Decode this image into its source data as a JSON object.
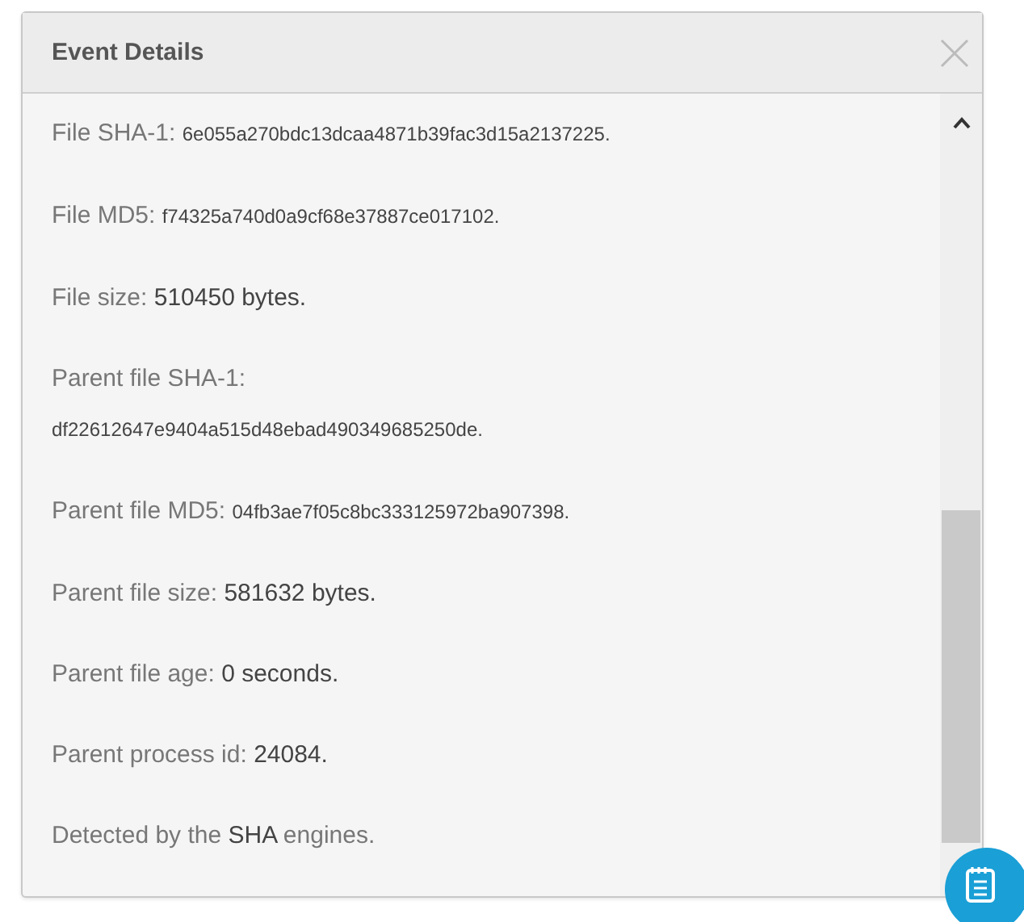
{
  "dialog": {
    "title": "Event Details"
  },
  "details": [
    {
      "parts": [
        {
          "kind": "label",
          "text": "File SHA-1: "
        },
        {
          "kind": "hash",
          "text": "6e055a270bdc13dcaa4871b39fac3d15a2137225."
        }
      ]
    },
    {
      "parts": [
        {
          "kind": "label",
          "text": "File MD5: "
        },
        {
          "kind": "hash",
          "text": "f74325a740d0a9cf68e37887ce017102."
        }
      ]
    },
    {
      "parts": [
        {
          "kind": "label",
          "text": "File size: "
        },
        {
          "kind": "value",
          "text": "510450 bytes."
        }
      ]
    },
    {
      "parts": [
        {
          "kind": "label",
          "text": "Parent file SHA-1:"
        },
        {
          "kind": "hash_block",
          "text": "df22612647e9404a515d48ebad490349685250de."
        }
      ]
    },
    {
      "parts": [
        {
          "kind": "label",
          "text": "Parent file MD5: "
        },
        {
          "kind": "hash",
          "text": "04fb3ae7f05c8bc333125972ba907398."
        }
      ]
    },
    {
      "parts": [
        {
          "kind": "label",
          "text": "Parent file size: "
        },
        {
          "kind": "value",
          "text": "581632 bytes."
        }
      ]
    },
    {
      "parts": [
        {
          "kind": "label",
          "text": "Parent file age: "
        },
        {
          "kind": "value",
          "text": "0 seconds."
        }
      ]
    },
    {
      "parts": [
        {
          "kind": "label",
          "text": "Parent process id: "
        },
        {
          "kind": "value",
          "text": "24084."
        }
      ]
    },
    {
      "parts": [
        {
          "kind": "label",
          "text": "Detected by the "
        },
        {
          "kind": "value",
          "text": "SHA"
        },
        {
          "kind": "label",
          "text": " engines."
        }
      ]
    }
  ]
}
